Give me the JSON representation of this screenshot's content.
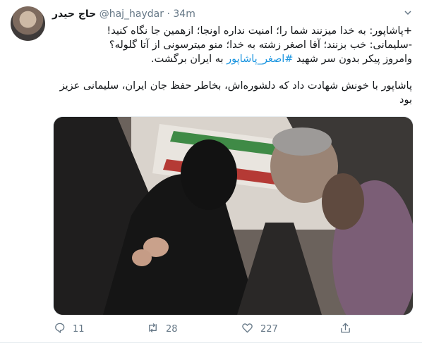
{
  "tweet": {
    "display_name": "حاج حیدر",
    "handle": "@haj_haydar",
    "separator": "·",
    "time": "34m",
    "lines": [
      "+پاشاپور: به خدا میزنند شما را؛ امنیت نداره اونجا؛ ازهمین جا نگاه کنید!",
      "-سلیمانی: خب بزنند؛ آقا اصغر زشته به خدا؛ منو میترسونی از آتا گلوله؟"
    ],
    "line3_before": "وامروز پیکر بدون سر شهید ",
    "hashtag": "#اصغر_پاشاپور",
    "line3_after": " به ایران برگشت.",
    "paragraph2": "پاشاپور با خونش شهادت داد که دلشوره‌اش، بخاطر حفظ جان ایران، سلیمانی عزیز بود",
    "stats": {
      "replies": "11",
      "retweets": "28",
      "likes": "227"
    },
    "icons": {
      "caret": "chevron-down-icon",
      "reply": "reply-icon",
      "retweet": "retweet-icon",
      "like": "heart-icon",
      "share": "share-icon"
    },
    "colors": {
      "link": "#1b95e0",
      "muted": "#657786",
      "text": "#14171a"
    }
  }
}
